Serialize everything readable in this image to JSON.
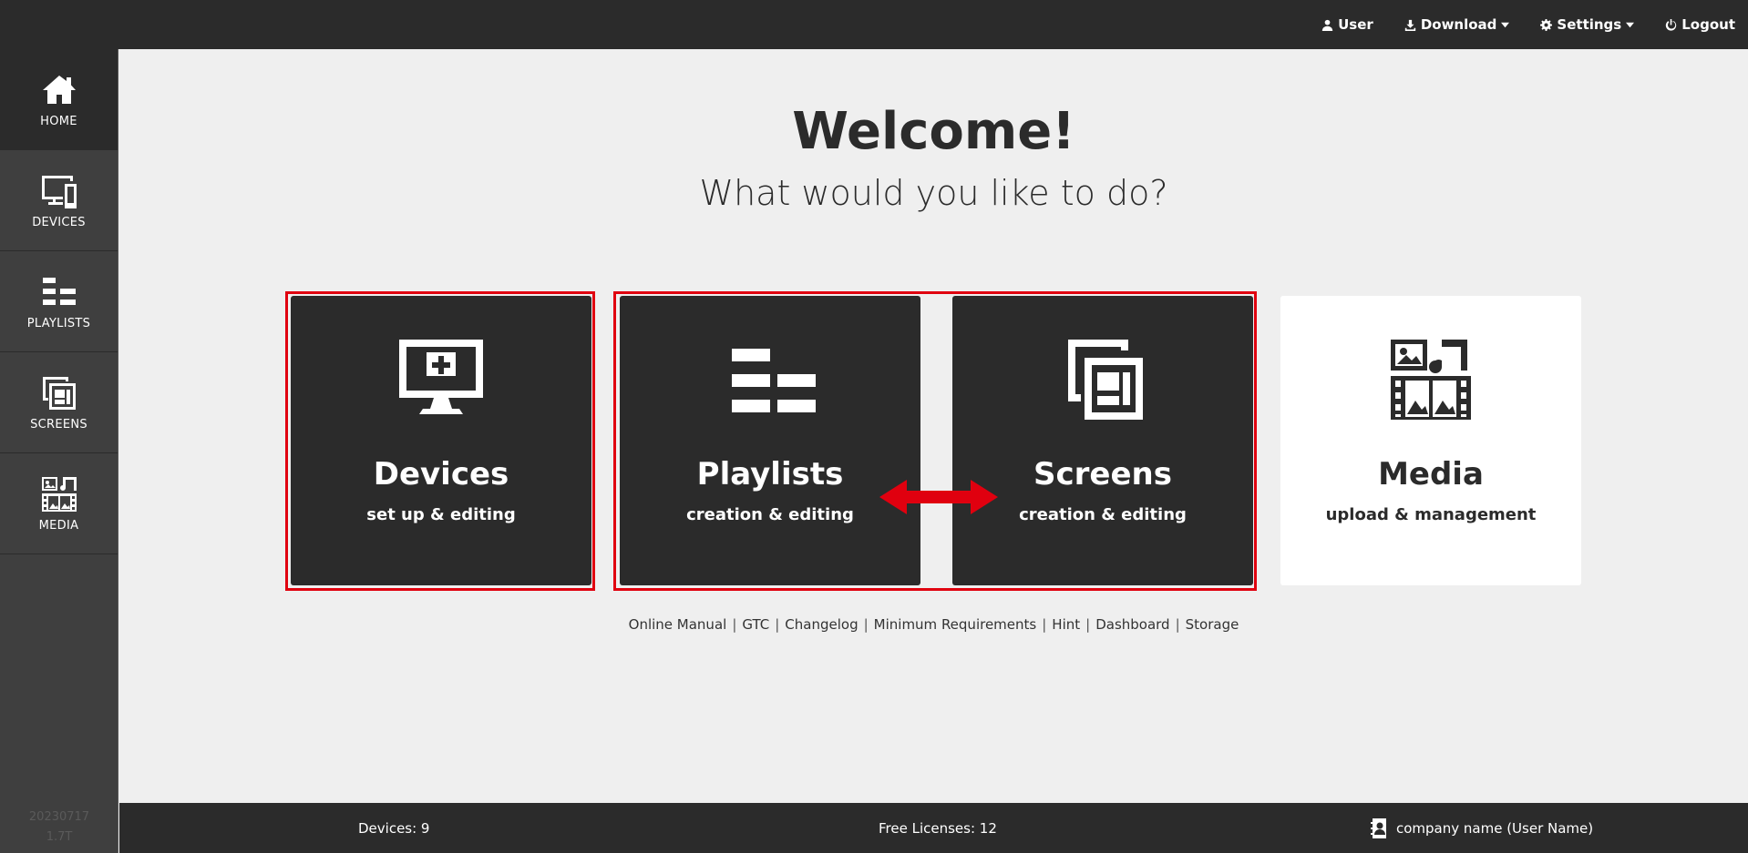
{
  "topnav": {
    "user": "User",
    "download": "Download",
    "settings": "Settings",
    "logout": "Logout"
  },
  "sidebar": {
    "items": [
      {
        "label": "HOME",
        "icon": "home-icon",
        "active": true
      },
      {
        "label": "DEVICES",
        "icon": "devices-icon"
      },
      {
        "label": "PLAYLISTS",
        "icon": "playlists-icon"
      },
      {
        "label": "SCREENS",
        "icon": "screens-icon"
      },
      {
        "label": "MEDIA",
        "icon": "media-icon"
      }
    ],
    "version_date": "20230717",
    "version_num": "1.7T"
  },
  "main": {
    "title": "Welcome!",
    "subtitle": "What would you like to do?",
    "cards": [
      {
        "title": "Devices",
        "subtitle": "set up & editing",
        "icon": "monitor-plus-icon"
      },
      {
        "title": "Playlists",
        "subtitle": "creation & editing",
        "icon": "playlists-icon"
      },
      {
        "title": "Screens",
        "subtitle": "creation & editing",
        "icon": "screens-icon"
      },
      {
        "title": "Media",
        "subtitle": "upload & management",
        "icon": "media-icon"
      }
    ],
    "links": [
      "Online Manual",
      "GTC",
      "Changelog",
      "Minimum Requirements",
      "Hint",
      "Dashboard",
      "Storage"
    ]
  },
  "footer": {
    "devices": "Devices: 9",
    "licenses": "Free Licenses: 12",
    "account": "company name (User Name)"
  },
  "colors": {
    "dark": "#2b2b2b",
    "sidebar": "#3f3f3f",
    "background": "#efefef",
    "highlight": "#e0000f"
  }
}
